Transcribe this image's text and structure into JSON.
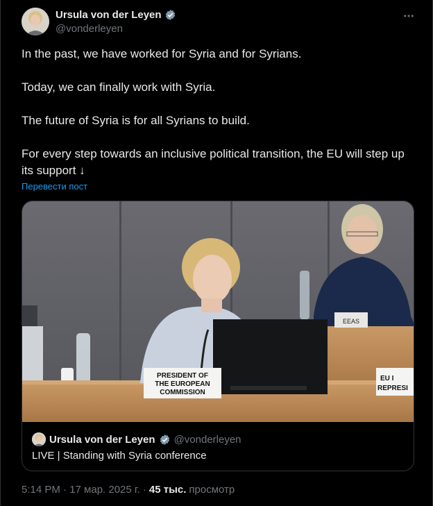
{
  "author": {
    "name": "Ursula von der Leyen",
    "handle": "@vonderleyen",
    "verified": true
  },
  "tweet": {
    "paragraphs": [
      "In the past, we have worked for Syria and for Syrians.",
      "Today, we can finally work with Syria.",
      "The future of Syria is for all Syrians to build.",
      "For every step towards an inclusive political transition, the EU will step up its support ↓"
    ],
    "translate_label": "Перевести пост"
  },
  "media": {
    "nameplate": "PRESIDENT OF THE EUROPEAN COMMISSION",
    "nameplate_lines": [
      "PRESIDENT OF",
      "THE EUROPEAN",
      "COMMISSION"
    ],
    "eeas_label": "EEAS",
    "eu_label_lines": [
      "EU I",
      "REPRESI"
    ]
  },
  "quoted": {
    "name": "Ursula von der Leyen",
    "handle": "@vonderleyen",
    "text": "LIVE | Standing with Syria conference"
  },
  "meta": {
    "time": "5:14 PM · 17 мар. 2025 г. ·",
    "views_count": "45 тыс.",
    "views_label": "просмотр"
  },
  "colors": {
    "background": "#000000",
    "text": "#e7e9ea",
    "muted": "#71767b",
    "link": "#1d9bf0",
    "verified": "#829aab",
    "border": "#2f3336"
  },
  "icons": [
    "verified-badge-icon",
    "more-options-icon"
  ]
}
